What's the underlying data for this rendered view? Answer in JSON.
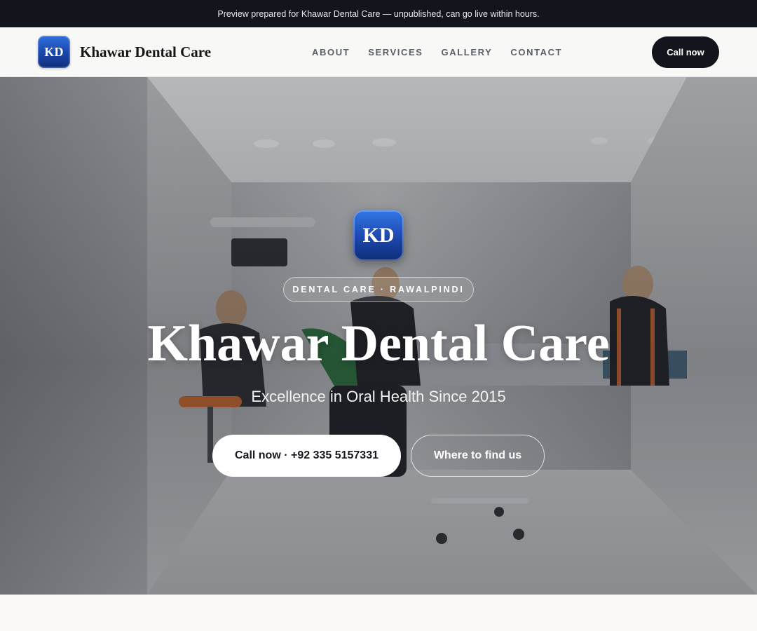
{
  "preview_bar": {
    "text": "Preview prepared for Khawar Dental Care — unpublished, can go live within hours."
  },
  "nav": {
    "logo_initials": "KD",
    "brand_name": "Khawar Dental Care",
    "links": [
      "ABOUT",
      "SERVICES",
      "GALLERY",
      "CONTACT"
    ],
    "cta_label": "Call now"
  },
  "hero": {
    "logo_initials": "KD",
    "badge": "DENTAL CARE · RAWALPINDI",
    "title": "Khawar Dental Care",
    "subtitle": "Excellence in Oral Health Since 2015",
    "primary_button": "Call now · +92 335 5157331",
    "secondary_button": "Where to find us",
    "background_image": "dental clinic interior with dentists treating a patient"
  },
  "colors": {
    "dark": "#12151b",
    "logo_blue": "#1a44a8",
    "page_bg": "#faf9f6"
  }
}
